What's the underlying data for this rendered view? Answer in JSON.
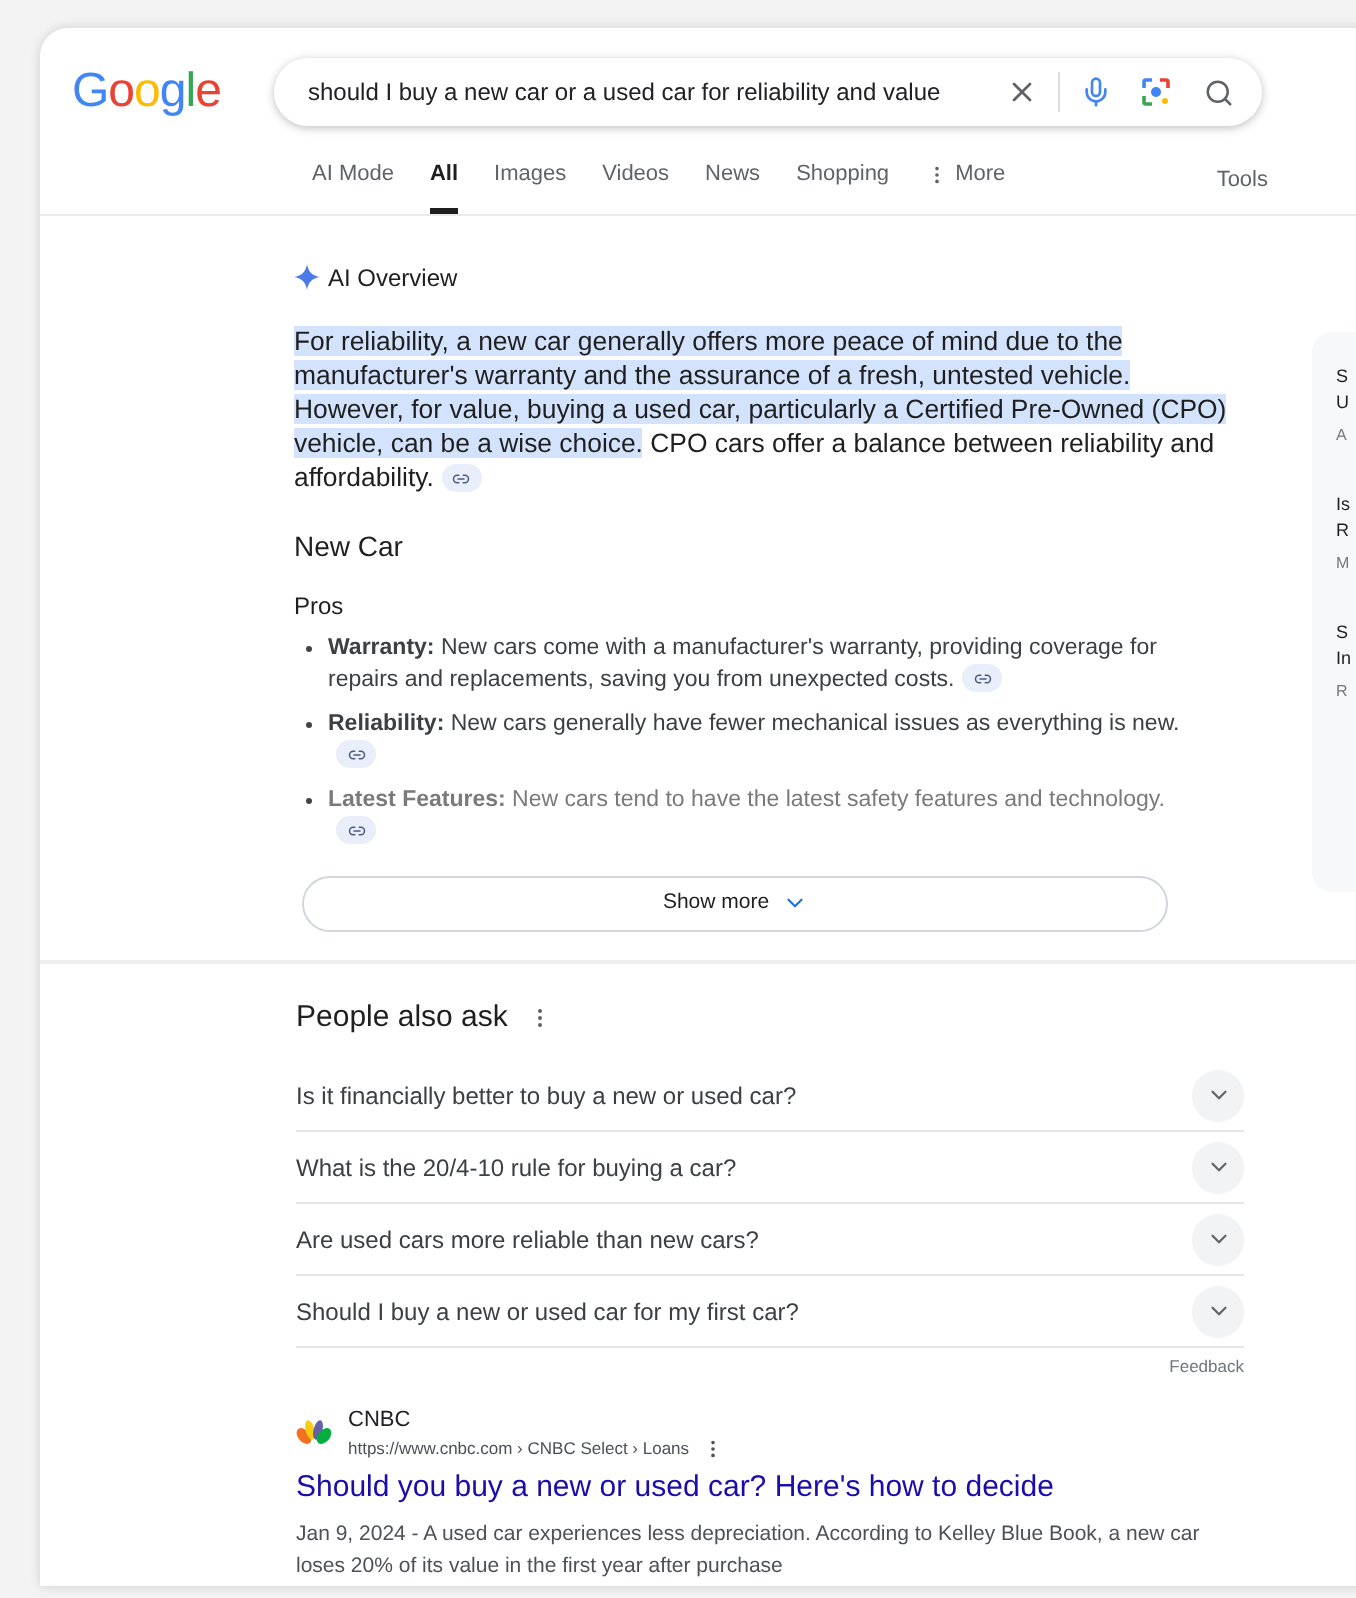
{
  "logo": [
    {
      "letter": "G",
      "color": "#4285f4"
    },
    {
      "letter": "o",
      "color": "#ea4335"
    },
    {
      "letter": "o",
      "color": "#fbbc05"
    },
    {
      "letter": "g",
      "color": "#4285f4"
    },
    {
      "letter": "l",
      "color": "#34a853"
    },
    {
      "letter": "e",
      "color": "#ea4335"
    }
  ],
  "search": {
    "value": "should I buy a new car or a used car for reliability and value"
  },
  "tabs": [
    {
      "label": "AI Mode",
      "selected": false,
      "kind": "plain"
    },
    {
      "label": "All",
      "selected": true,
      "kind": "plain"
    },
    {
      "label": "Images",
      "selected": false,
      "kind": "plain"
    },
    {
      "label": "Videos",
      "selected": false,
      "kind": "plain"
    },
    {
      "label": "News",
      "selected": false,
      "kind": "plain"
    },
    {
      "label": "Shopping",
      "selected": false,
      "kind": "plain"
    },
    {
      "label": "More",
      "selected": false,
      "kind": "menu"
    }
  ],
  "tools": "Tools",
  "ai_overview": {
    "title": "AI Overview",
    "paragraph": [
      {
        "text": "For reliability, a new car generally offers more peace of mind due to the manufacturer's warranty and the assurance of a fresh, untested vehicle. However, for value, buying a used car, particularly a Certified Pre-Owned (CPO) vehicle, can be a wise choice.",
        "selected": true
      },
      {
        "text": " CPO cars offer a balance between reliability and affordability.",
        "selected": false
      }
    ],
    "section": "New Car",
    "subsection": "Pros",
    "bullets": [
      "**Warranty:** New cars come with a manufacturer's warranty, providing coverage for repairs and replacements, saving you from unexpected costs.",
      "**Reliability:** New cars generally have fewer mechanical issues as everything is new.",
      "**Latest Features:** New cars tend to have the latest safety features and technology."
    ],
    "show_more": "Show more"
  },
  "side_cards": [
    {
      "lines": [
        "S",
        "U"
      ],
      "source": "A"
    },
    {
      "lines": [
        "Is",
        "R"
      ],
      "source": "M"
    },
    {
      "lines": [
        "S",
        "In"
      ],
      "source": "R"
    }
  ],
  "people_also_ask": {
    "title": "People also ask",
    "questions": [
      "Is it financially better to buy a new or used car?",
      "What is the 20/4-10 rule for buying a car?",
      "Are used cars more reliable than new cars?",
      "Should I buy a new or used car for my first car?"
    ],
    "feedback": "Feedback"
  },
  "result": {
    "site": "CNBC",
    "breadcrumb": "https://www.cnbc.com › CNBC Select › Loans",
    "title": "Should you buy a new or used car? Here's how to decide",
    "snippet": "Jan 9, 2024 - A used car experiences less depreciation. According to Kelley Blue Book, a new car loses 20% of its value in the first year after purchase"
  }
}
